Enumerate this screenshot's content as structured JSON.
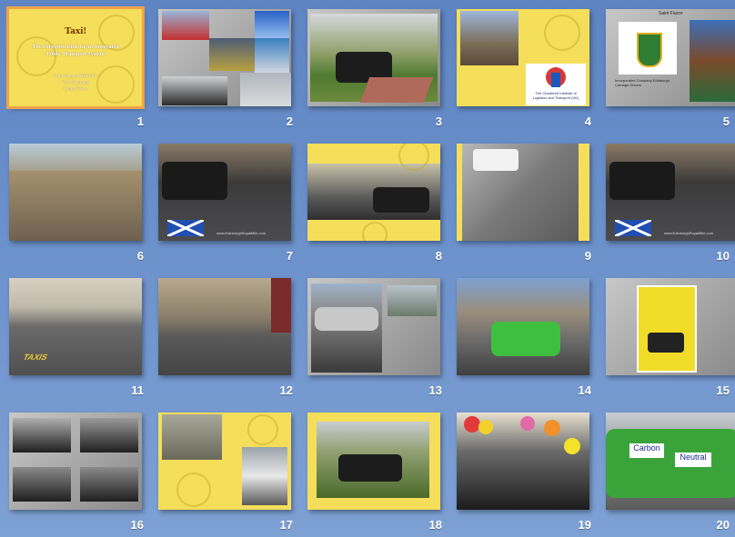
{
  "slide_sorter": {
    "slides": [
      {
        "number": "1",
        "title": "Taxi!",
        "subtitle": "The Forgotten Link In An Integrated Public Transport System",
        "byline": "Tom Kenyon FIRM (?)",
        "byline2": "Vice Chairman",
        "byline3": "Central Taxis"
      },
      {
        "number": "2"
      },
      {
        "number": "3"
      },
      {
        "number": "4",
        "logo_text": "The Chartered Institute of Logistics and Transport (UK)"
      },
      {
        "number": "5",
        "header": "Saint Fiacre",
        "caption": "Incorporated Company Edinburgh Carriage Drivers"
      },
      {
        "number": "6"
      },
      {
        "number": "7",
        "credit": "www.EdinburghRoyalMile.com"
      },
      {
        "number": "8"
      },
      {
        "number": "9"
      },
      {
        "number": "10",
        "credit": "www.EdinburghRoyalMile.com"
      },
      {
        "number": "11",
        "road_text": "TAXIS"
      },
      {
        "number": "12"
      },
      {
        "number": "13"
      },
      {
        "number": "14"
      },
      {
        "number": "15"
      },
      {
        "number": "16"
      },
      {
        "number": "17"
      },
      {
        "number": "18"
      },
      {
        "number": "19"
      },
      {
        "number": "20",
        "sign1": "Carbon",
        "sign2": "Neutral"
      }
    ]
  }
}
